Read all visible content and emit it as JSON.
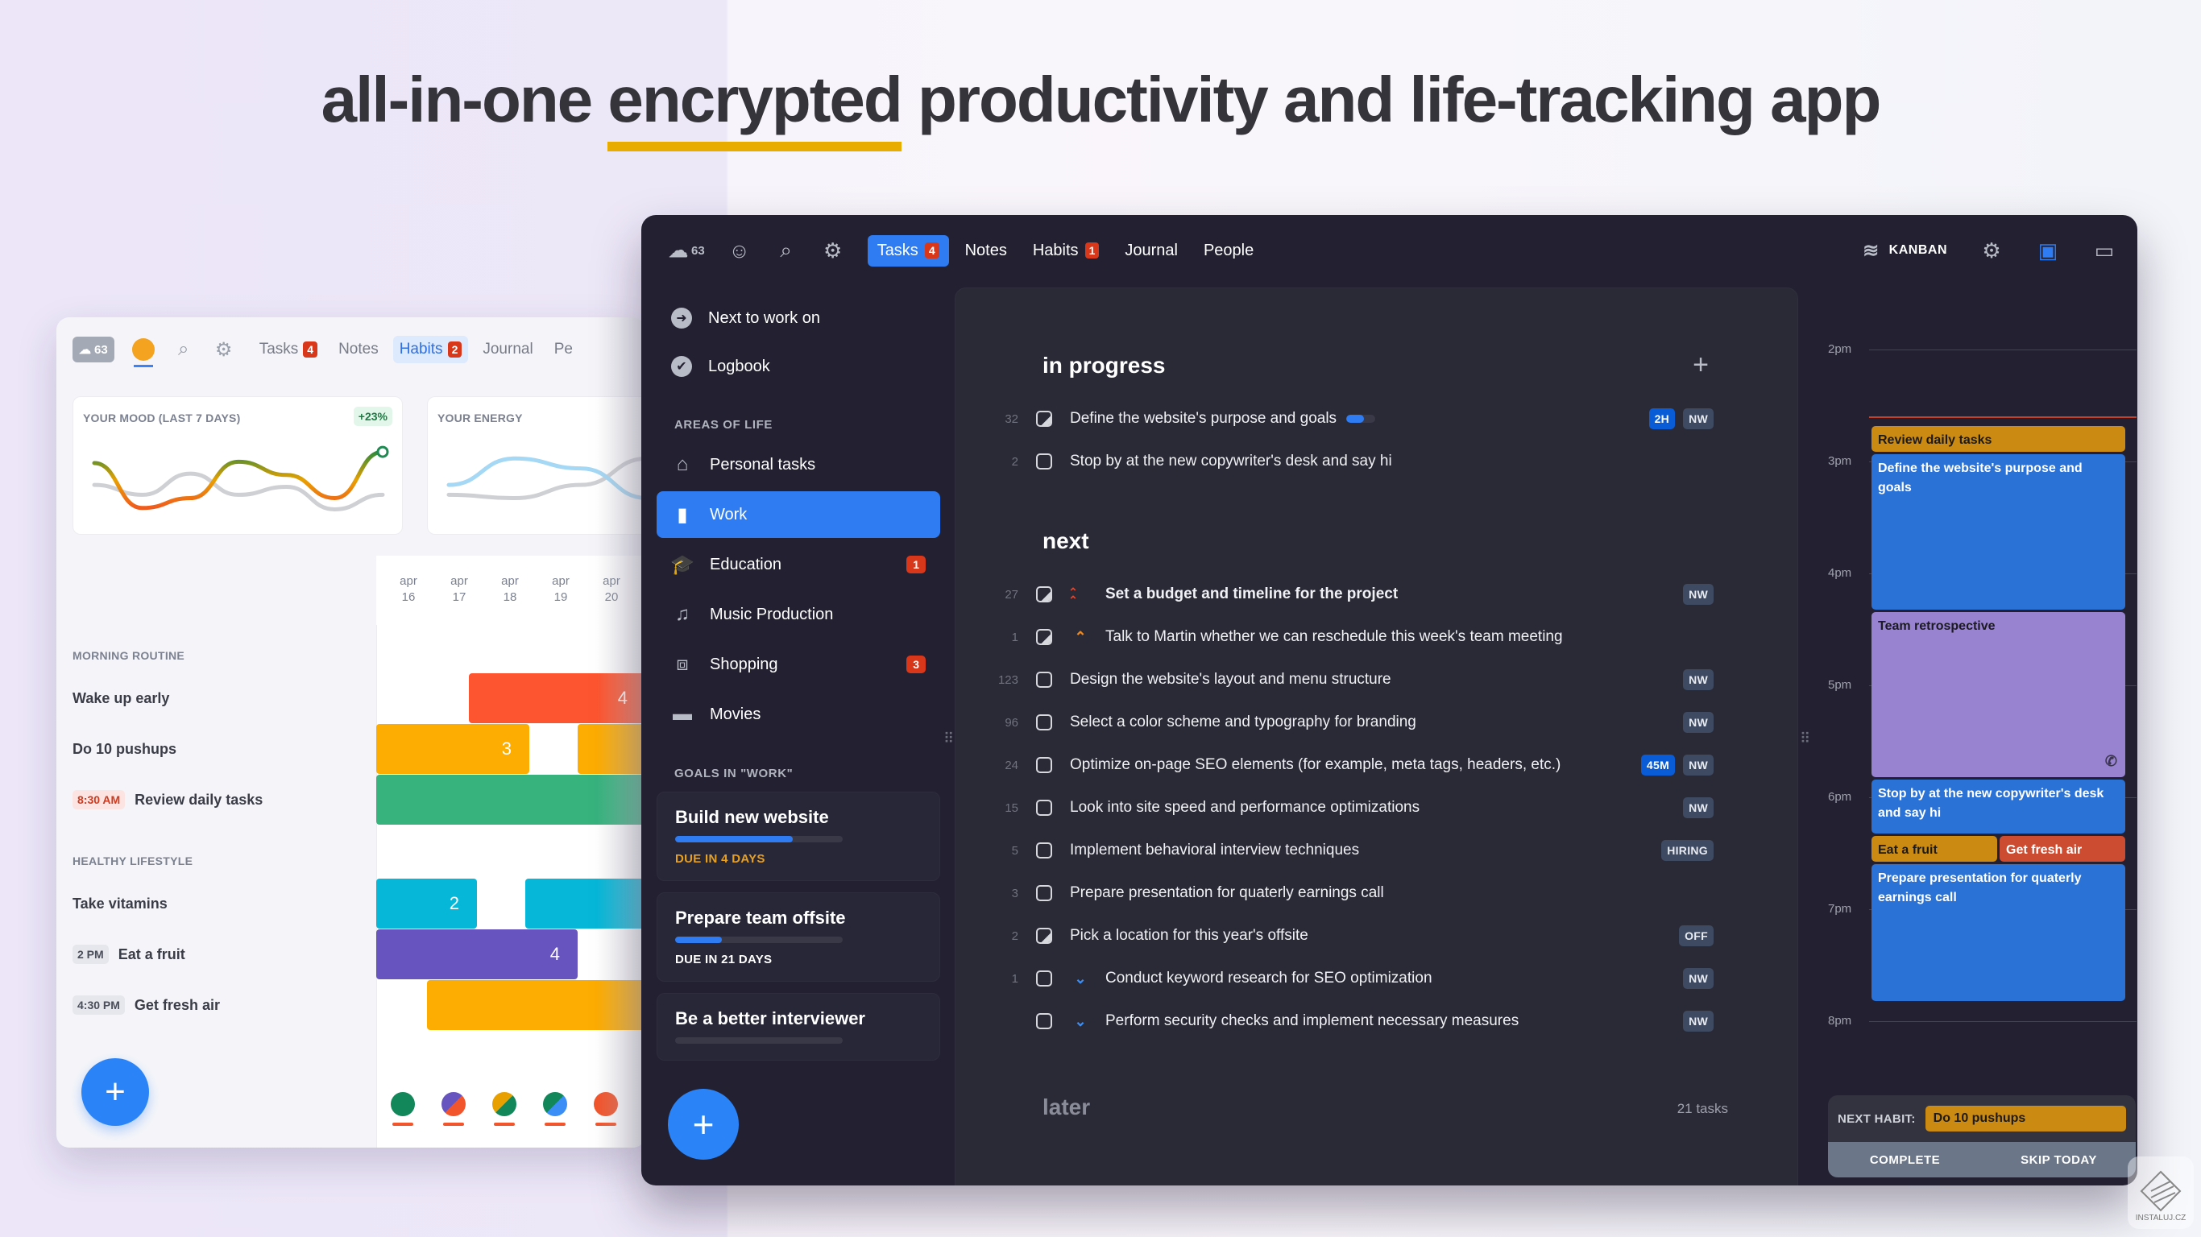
{
  "headline": {
    "before": "all-in-one ",
    "highlight": "encrypted",
    "after": " productivity and life-tracking app",
    "highlight_color": "#e8ac00"
  },
  "light_window": {
    "weather": {
      "icon": "rain-cloud-icon",
      "value": "63"
    },
    "toolbar_icons": [
      "mood-face-icon",
      "search-icon",
      "gear-icon"
    ],
    "tabs": [
      {
        "label": "Tasks",
        "badge": "4",
        "active": false
      },
      {
        "label": "Notes",
        "badge": null,
        "active": false
      },
      {
        "label": "Habits",
        "badge": "2",
        "active": true
      },
      {
        "label": "Journal",
        "badge": null,
        "active": false
      },
      {
        "label": "Pe",
        "badge": null,
        "active": false
      }
    ],
    "mood_card": {
      "title": "YOUR MOOD (LAST 7 DAYS)",
      "change": "+23%",
      "series_current": [
        0.78,
        0.1,
        0.25,
        0.8,
        0.6,
        0.25,
        0.95
      ],
      "series_previous": [
        0.45,
        0.3,
        0.62,
        0.3,
        0.42,
        0.08,
        0.3
      ]
    },
    "energy_card": {
      "title": "YOUR ENERGY",
      "series_current": [
        0.45,
        0.85,
        0.7,
        0.25,
        0.5
      ],
      "series_previous": [
        0.3,
        0.25,
        0.45,
        0.85,
        0.2
      ]
    },
    "dates": [
      {
        "month": "apr",
        "day": "16"
      },
      {
        "month": "apr",
        "day": "17"
      },
      {
        "month": "apr",
        "day": "18"
      },
      {
        "month": "apr",
        "day": "19"
      },
      {
        "month": "apr",
        "day": "20"
      }
    ],
    "sections": [
      {
        "title": "MORNING ROUTINE",
        "habits": [
          {
            "name": "Wake up early",
            "time": null,
            "streak": "4",
            "color": "#fd552f"
          },
          {
            "name": "Do 10 pushups",
            "time": null,
            "streak": "3",
            "color": "#fdac02"
          },
          {
            "name": "Review daily tasks",
            "time": "8:30 AM",
            "time_style": "red",
            "streak": null,
            "color": "#37b37e"
          }
        ]
      },
      {
        "title": "HEALTHY LIFESTYLE",
        "habits": [
          {
            "name": "Take vitamins",
            "time": null,
            "streak": "2",
            "color": "#06b7d8"
          },
          {
            "name": "Eat a fruit",
            "time": "2 PM",
            "time_style": "gray",
            "streak": "4",
            "color": "#6754bf"
          },
          {
            "name": "Get fresh air",
            "time": "4:30 PM",
            "time_style": "gray",
            "streak": null,
            "color": "#fdac02"
          }
        ]
      }
    ],
    "fab_label": "+"
  },
  "dark_window": {
    "weather": {
      "icon": "rain-cloud-icon",
      "value": "63"
    },
    "toolbar_icons": [
      "neutral-face-icon",
      "search-icon",
      "gear-icon"
    ],
    "tabs": [
      {
        "label": "Tasks",
        "badge": "4",
        "active": true
      },
      {
        "label": "Notes",
        "badge": null,
        "active": false
      },
      {
        "label": "Habits",
        "badge": "1",
        "active": false
      },
      {
        "label": "Journal",
        "badge": null,
        "active": false
      },
      {
        "label": "People",
        "badge": null,
        "active": false
      }
    ],
    "view_mode": "KANBAN",
    "sidebar": {
      "top_items": [
        {
          "label": "Next to work on",
          "icon": "arrow-circle-icon"
        },
        {
          "label": "Logbook",
          "icon": "check-circle-icon"
        }
      ],
      "areas_title": "AREAS OF LIFE",
      "areas": [
        {
          "label": "Personal tasks",
          "icon": "home-icon",
          "badge": null,
          "active": false
        },
        {
          "label": "Work",
          "icon": "briefcase-icon",
          "badge": null,
          "active": true
        },
        {
          "label": "Education",
          "icon": "graduation-cap-icon",
          "badge": "1",
          "active": false
        },
        {
          "label": "Music Production",
          "icon": "music-note-icon",
          "badge": null,
          "active": false
        },
        {
          "label": "Shopping",
          "icon": "basket-icon",
          "badge": "3",
          "active": false
        },
        {
          "label": "Movies",
          "icon": "clapperboard-icon",
          "badge": null,
          "active": false
        }
      ],
      "goals_title": "GOALS IN \"WORK\"",
      "goals": [
        {
          "title": "Build new website",
          "progress": 0.7,
          "due": "DUE IN 4 DAYS",
          "warn": true
        },
        {
          "title": "Prepare team offsite",
          "progress": 0.28,
          "due": "DUE IN 21 DAYS",
          "warn": false
        },
        {
          "title": "Be a better interviewer",
          "progress": 0,
          "due": null,
          "warn": false
        }
      ]
    },
    "sections": [
      {
        "title": "in progress",
        "tasks": [
          {
            "num": "32",
            "check": "half",
            "priority": null,
            "label": "Define the website's purpose and goals",
            "bold": false,
            "progress": 0.6,
            "tags": [
              {
                "text": "2H",
                "style": "blue"
              },
              {
                "text": "NW",
                "style": "gray"
              }
            ]
          },
          {
            "num": "2",
            "check": "empty",
            "priority": null,
            "label": "Stop by at the new copywriter's desk and say hi",
            "bold": false,
            "progress": null,
            "tags": []
          }
        ]
      },
      {
        "title": "next",
        "tasks": [
          {
            "num": "27",
            "check": "half",
            "priority": "urgent",
            "label": "Set a budget and timeline for the project",
            "bold": true,
            "progress": null,
            "tags": [
              {
                "text": "NW",
                "style": "gray"
              }
            ]
          },
          {
            "num": "1",
            "check": "half",
            "priority": "high",
            "label": "Talk to Martin whether we can reschedule this week's team meeting",
            "bold": false,
            "progress": null,
            "tags": []
          },
          {
            "num": "123",
            "check": "empty",
            "priority": null,
            "label": "Design the website's layout and menu structure",
            "bold": false,
            "progress": null,
            "tags": [
              {
                "text": "NW",
                "style": "gray"
              }
            ]
          },
          {
            "num": "96",
            "check": "empty",
            "priority": null,
            "label": "Select a color scheme and typography for branding",
            "bold": false,
            "progress": null,
            "tags": [
              {
                "text": "NW",
                "style": "gray"
              }
            ]
          },
          {
            "num": "24",
            "check": "empty",
            "priority": null,
            "label": "Optimize on-page SEO elements (for example, meta tags, headers, etc.)",
            "bold": false,
            "progress": null,
            "tags": [
              {
                "text": "45M",
                "style": "blue"
              },
              {
                "text": "NW",
                "style": "gray"
              }
            ]
          },
          {
            "num": "15",
            "check": "empty",
            "priority": null,
            "label": "Look into site speed and performance optimizations",
            "bold": false,
            "progress": null,
            "tags": [
              {
                "text": "NW",
                "style": "gray"
              }
            ]
          },
          {
            "num": "5",
            "check": "empty",
            "priority": null,
            "label": "Implement behavioral interview techniques",
            "bold": false,
            "progress": null,
            "tags": [
              {
                "text": "HIRING",
                "style": "gray"
              }
            ]
          },
          {
            "num": "3",
            "check": "empty",
            "priority": null,
            "label": "Prepare presentation for quaterly earnings call",
            "bold": false,
            "progress": null,
            "tags": []
          },
          {
            "num": "2",
            "check": "half",
            "priority": null,
            "label": "Pick a location for this year's offsite",
            "bold": false,
            "progress": null,
            "tags": [
              {
                "text": "OFF",
                "style": "gray"
              }
            ]
          },
          {
            "num": "1",
            "check": "empty",
            "priority": "low",
            "label": "Conduct keyword research for SEO optimization",
            "bold": false,
            "progress": null,
            "tags": [
              {
                "text": "NW",
                "style": "gray"
              }
            ]
          },
          {
            "num": "",
            "check": "empty",
            "priority": "low",
            "label": "Perform security checks and implement necessary measures",
            "bold": false,
            "progress": null,
            "tags": [
              {
                "text": "NW",
                "style": "gray"
              }
            ]
          }
        ]
      },
      {
        "title": "later",
        "count": "21 tasks"
      }
    ],
    "priority_glyphs": {
      "urgent": "⌃⌃",
      "high": "⌃",
      "low": "⌄"
    },
    "priority_colors": {
      "urgent": "#e8452a",
      "high": "#ef8b1e",
      "low": "#3b8ef5"
    },
    "calendar": {
      "hours": [
        "2pm",
        "3pm",
        "4pm",
        "5pm",
        "6pm",
        "7pm",
        "8pm"
      ],
      "now": "2:35pm",
      "events": [
        {
          "title": "Review daily tasks",
          "start": 14.67,
          "end": 14.92,
          "col": 0,
          "cols": 1,
          "color": "amber"
        },
        {
          "title": "Define the website's purpose and goals",
          "start": 14.92,
          "end": 16.33,
          "col": 0,
          "cols": 1,
          "color": "blue"
        },
        {
          "title": "Team retrospective",
          "start": 16.33,
          "end": 17.83,
          "col": 0,
          "cols": 1,
          "color": "purple",
          "icon": "phone-icon"
        },
        {
          "title": "Stop by at the new copywriter's desk and say hi",
          "start": 17.83,
          "end": 18.33,
          "col": 0,
          "cols": 1,
          "color": "blue"
        },
        {
          "title": "Eat a fruit",
          "start": 18.33,
          "end": 18.58,
          "col": 0,
          "cols": 2,
          "color": "amber"
        },
        {
          "title": "Get fresh air",
          "start": 18.33,
          "end": 18.58,
          "col": 1,
          "cols": 2,
          "color": "red"
        },
        {
          "title": "Prepare presentation for quaterly earnings call",
          "start": 18.58,
          "end": 19.83,
          "col": 0,
          "cols": 1,
          "color": "blue"
        }
      ]
    },
    "next_habit": {
      "label": "NEXT HABIT:",
      "value": "Do 10 pushups",
      "complete": "COMPLETE",
      "skip": "SKIP TODAY"
    },
    "fab_label": "+"
  },
  "watermark": "INSTALUJ.CZ"
}
